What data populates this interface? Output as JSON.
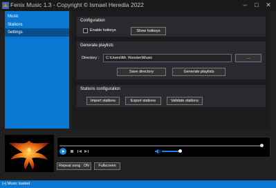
{
  "window": {
    "title": "Fenix Music 1.3 - Copyright © Ismael Heredia 2022"
  },
  "colors": {
    "accent": "#0a78d2",
    "accent_active": "#064f8e",
    "panel": "#2a2a30"
  },
  "sidebar": {
    "items": [
      {
        "label": "Music"
      },
      {
        "label": "Stations"
      },
      {
        "label": "Settings",
        "active": true
      }
    ]
  },
  "configuration": {
    "title": "Configuration",
    "hotkeys_label": "Enable hotkeys",
    "hotkeys_checked": false,
    "show_hotkeys_label": "Show hotkeys"
  },
  "playlists": {
    "title": "Generate playlists",
    "directory_label": "Directory :",
    "directory_value": "C:\\Users\\Mr. Rooster\\Music",
    "browse_label": "...",
    "save_label": "Save directory",
    "generate_label": "Generate playlists"
  },
  "stations": {
    "title": "Stations configuration",
    "import_label": "Import stations",
    "export_label": "Export stations",
    "validate_label": "Validate stations"
  },
  "player": {
    "repeat_label": "Repeat song : ON",
    "fullscreen_label": "Fullscreen"
  },
  "status": {
    "text": "[+] Music loaded"
  }
}
